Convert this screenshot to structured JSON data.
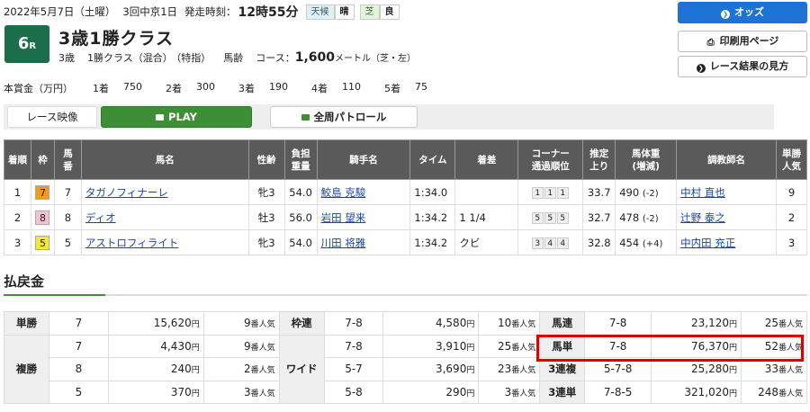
{
  "header": {
    "date": "2022年5月7日（土曜）",
    "meeting": "3回中京1日",
    "post_time_label": "発走時刻：",
    "post_time": "12時55分",
    "weather_label": "天候",
    "weather": "晴",
    "track_label": "芝",
    "track_condition": "良"
  },
  "race": {
    "number": "6",
    "number_suffix": "R",
    "title": "3歳1勝クラス",
    "cond_age": "3歳",
    "cond_class": "1勝クラス（混合）",
    "cond_special": "（特指）",
    "cond_weight": "馬齢",
    "course_label": "コース：",
    "distance": "1,600",
    "distance_unit": "メートル（芝・左）"
  },
  "side_buttons": {
    "odds": "オッズ",
    "print": "印刷用ページ",
    "howto": "レース結果の見方"
  },
  "prize": {
    "label": "本賞金（万円）",
    "items": [
      {
        "place": "1着",
        "value": "750"
      },
      {
        "place": "2着",
        "value": "300"
      },
      {
        "place": "3着",
        "value": "190"
      },
      {
        "place": "4着",
        "value": "110"
      },
      {
        "place": "5着",
        "value": "75"
      }
    ]
  },
  "video": {
    "label": "レース映像",
    "play": "PLAY",
    "patrol": "全周パトロール"
  },
  "results": {
    "headers": {
      "rank": "着順",
      "waku": "枠",
      "umaban": "馬\n番",
      "horse": "馬名",
      "sexage": "性齢",
      "weight_carried": "負担\n重量",
      "jockey": "騎手名",
      "time": "タイム",
      "margin": "着差",
      "corner": "コーナー\n通過順位",
      "last3f": "推定\n上り",
      "body": "馬体重\n(増減)",
      "trainer": "調教師名",
      "pop": "単勝\n人気"
    },
    "rows": [
      {
        "rank": "1",
        "waku": "7",
        "waku_color": "#f39a1e",
        "umaban": "7",
        "horse": "タガノフィナーレ",
        "sexage": "牝3",
        "weight": "54.0",
        "jockey": "鮫島 克駿",
        "time": "1:34.0",
        "margin": "",
        "corners": [
          "1",
          "1",
          "1"
        ],
        "last3f": "33.7",
        "body": "490",
        "body_diff": "(-2)",
        "trainer": "中村 直也",
        "pop": "9"
      },
      {
        "rank": "2",
        "waku": "8",
        "waku_color": "#f7c1d0",
        "umaban": "8",
        "horse": "ディオ",
        "sexage": "牡3",
        "weight": "56.0",
        "jockey": "岩田 望来",
        "time": "1:34.2",
        "margin": "1 1/4",
        "corners": [
          "5",
          "5",
          "5"
        ],
        "last3f": "32.7",
        "body": "478",
        "body_diff": "(-2)",
        "trainer": "辻野 泰之",
        "pop": "2"
      },
      {
        "rank": "3",
        "waku": "5",
        "waku_color": "#f4e63a",
        "umaban": "5",
        "horse": "アストロフィライト",
        "sexage": "牝3",
        "weight": "54.0",
        "jockey": "川田 将雅",
        "time": "1:34.2",
        "margin": "クビ",
        "corners": [
          "3",
          "4",
          "4"
        ],
        "last3f": "32.8",
        "body": "454",
        "body_diff": "(+4)",
        "trainer": "中内田 充正",
        "pop": "3"
      }
    ]
  },
  "payout": {
    "title": "払戻金",
    "yen": "円",
    "ninki_suffix": "番人気",
    "tansho": {
      "label": "単勝",
      "combo": "7",
      "amount": "15,620",
      "pop": "9"
    },
    "fukusho": {
      "label": "複勝",
      "rows": [
        {
          "combo": "7",
          "amount": "4,430",
          "pop": "9"
        },
        {
          "combo": "8",
          "amount": "240",
          "pop": "2"
        },
        {
          "combo": "5",
          "amount": "370",
          "pop": "3"
        }
      ]
    },
    "wakuren": {
      "label": "枠連",
      "combo": "7-8",
      "amount": "4,580",
      "pop": "10"
    },
    "wide": {
      "label": "ワイド",
      "rows": [
        {
          "combo": "7-8",
          "amount": "3,910",
          "pop": "25"
        },
        {
          "combo": "5-7",
          "amount": "3,690",
          "pop": "23"
        },
        {
          "combo": "5-8",
          "amount": "290",
          "pop": "3"
        }
      ]
    },
    "umaren": {
      "label": "馬連",
      "combo": "7-8",
      "amount": "23,120",
      "pop": "25"
    },
    "umatan": {
      "label": "馬単",
      "combo": "7-8",
      "amount": "76,370",
      "pop": "52"
    },
    "sanrenpuku": {
      "label": "3連複",
      "combo": "5-7-8",
      "amount": "25,280",
      "pop": "33"
    },
    "sanrentan": {
      "label": "3連単",
      "combo": "7-8-5",
      "amount": "321,020",
      "pop": "248"
    }
  },
  "colors": {
    "race_badge": "#1a6f4a",
    "odds_button": "#1d72d6",
    "play_button": "#3d8f35",
    "highlight": "#e00000",
    "table_header": "#5a5a5a",
    "link": "#1846a8"
  }
}
